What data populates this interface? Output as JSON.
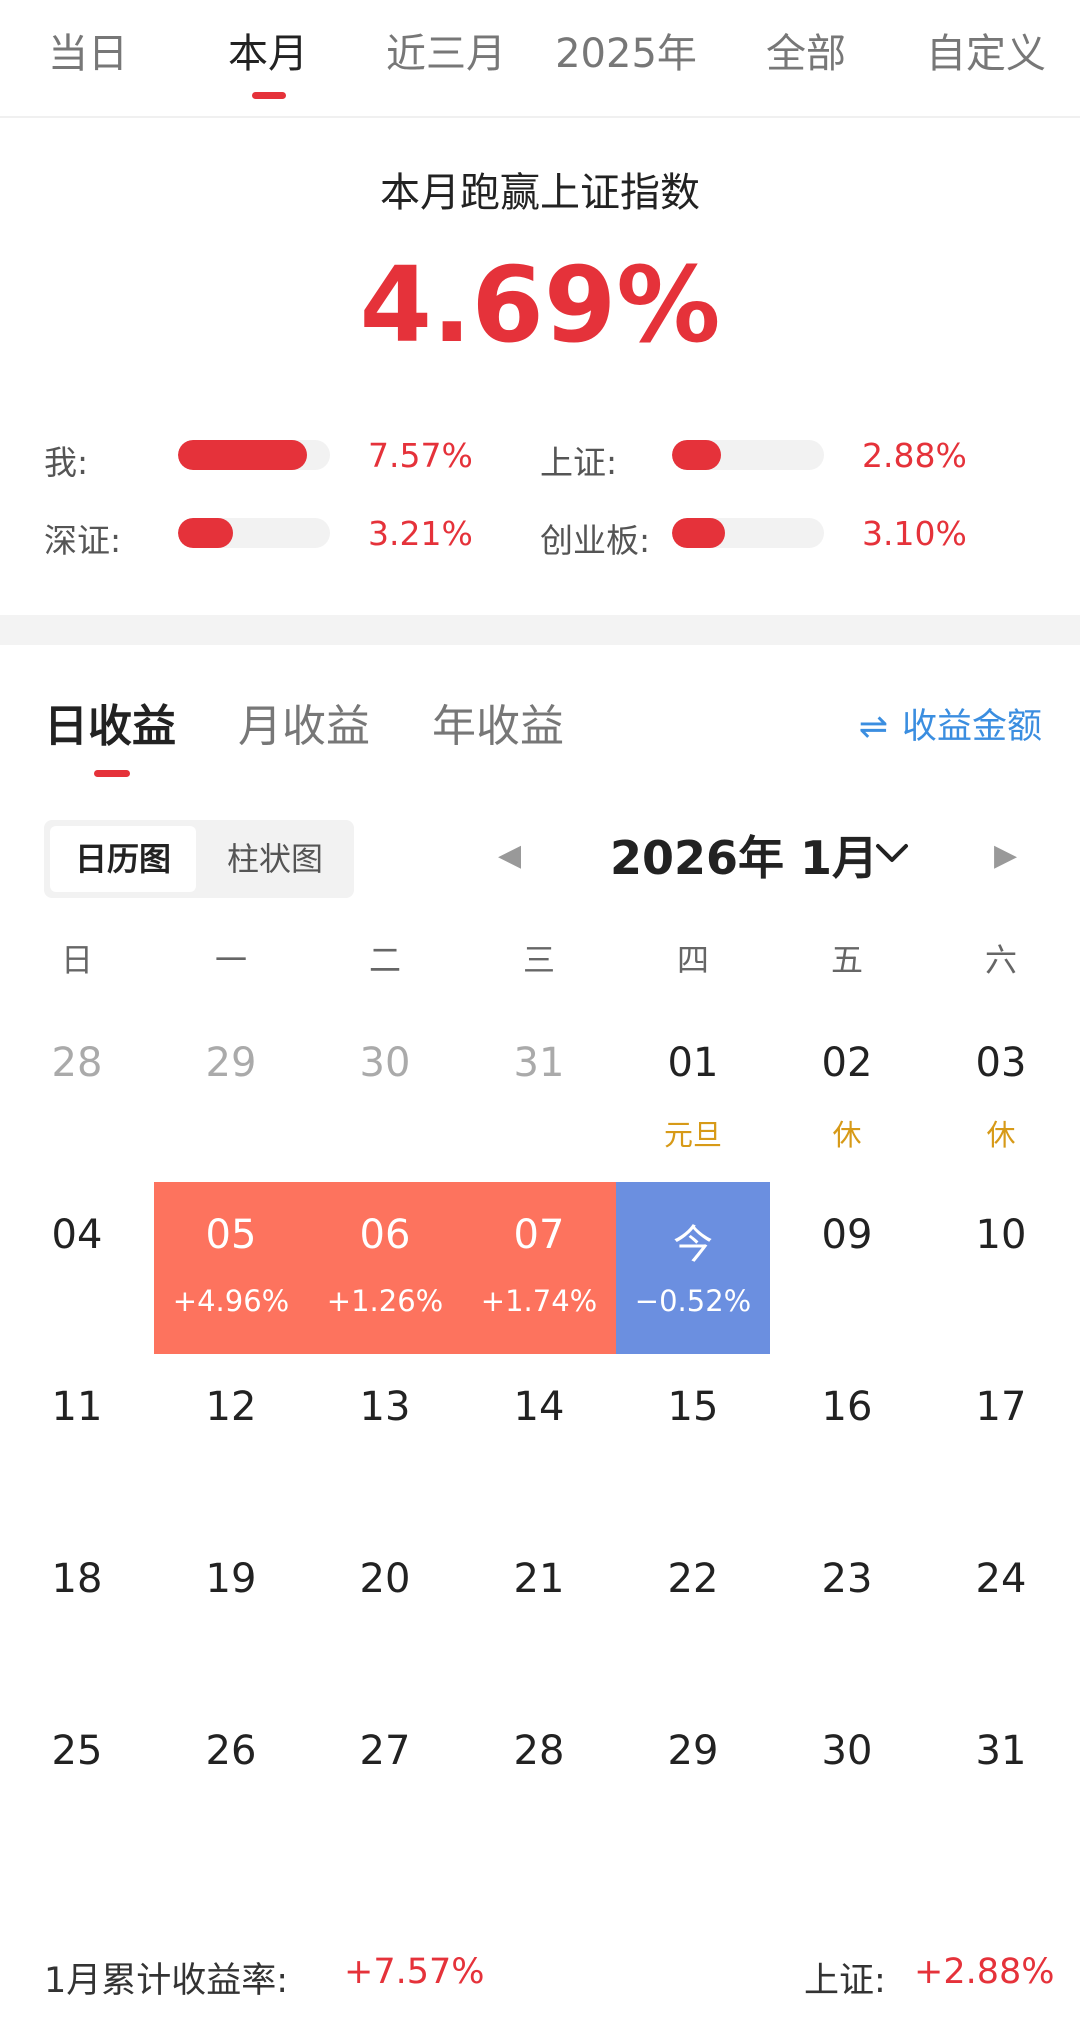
{
  "top_tabs": [
    {
      "label": "当日",
      "active": false
    },
    {
      "label": "本月",
      "active": true
    },
    {
      "label": "近三月",
      "active": false
    },
    {
      "label": "2025年",
      "active": false
    },
    {
      "label": "全部",
      "active": false
    },
    {
      "label": "自定义",
      "active": false
    }
  ],
  "outperform": {
    "title": "本月跑赢上证指数",
    "value": "4.69%"
  },
  "comparison": [
    {
      "label": "我:",
      "pct": "7.57%",
      "fill": 0.85
    },
    {
      "label": "上证:",
      "pct": "2.88%",
      "fill": 0.32
    },
    {
      "label": "深证:",
      "pct": "3.21%",
      "fill": 0.36
    },
    {
      "label": "创业板:",
      "pct": "3.10%",
      "fill": 0.35
    }
  ],
  "profit_tabs": [
    {
      "label": "日收益",
      "active": true
    },
    {
      "label": "月收益",
      "active": false
    },
    {
      "label": "年收益",
      "active": false
    }
  ],
  "amount_toggle": {
    "icon": "swap-icon",
    "glyph": "⇌",
    "label": "收益金额"
  },
  "view_switch": {
    "calendar": "日历图",
    "bar": "柱状图",
    "active": "日历图"
  },
  "month_nav": {
    "prev_glyph": "◀",
    "title": "2026年 1月",
    "next_glyph": "▶"
  },
  "weekdays": [
    "日",
    "一",
    "二",
    "三",
    "四",
    "五",
    "六"
  ],
  "calendar": [
    [
      {
        "day": "28",
        "muted": true
      },
      {
        "day": "29",
        "muted": true
      },
      {
        "day": "30",
        "muted": true
      },
      {
        "day": "31",
        "muted": true
      },
      {
        "day": "01",
        "sub": "元旦"
      },
      {
        "day": "02",
        "sub": "休"
      },
      {
        "day": "03",
        "sub": "休"
      }
    ],
    [
      {
        "day": "04"
      },
      {
        "day": "05",
        "sub": "+4.96%",
        "tone": "red"
      },
      {
        "day": "06",
        "sub": "+1.26%",
        "tone": "red"
      },
      {
        "day": "07",
        "sub": "+1.74%",
        "tone": "red"
      },
      {
        "day": "今",
        "sub": "−0.52%",
        "tone": "blue"
      },
      {
        "day": "09"
      },
      {
        "day": "10"
      }
    ],
    [
      {
        "day": "11"
      },
      {
        "day": "12"
      },
      {
        "day": "13"
      },
      {
        "day": "14"
      },
      {
        "day": "15"
      },
      {
        "day": "16"
      },
      {
        "day": "17"
      }
    ],
    [
      {
        "day": "18"
      },
      {
        "day": "19"
      },
      {
        "day": "20"
      },
      {
        "day": "21"
      },
      {
        "day": "22"
      },
      {
        "day": "23"
      },
      {
        "day": "24"
      }
    ],
    [
      {
        "day": "25"
      },
      {
        "day": "26"
      },
      {
        "day": "27"
      },
      {
        "day": "28"
      },
      {
        "day": "29"
      },
      {
        "day": "30"
      },
      {
        "day": "31"
      }
    ]
  ],
  "footer": {
    "left_label": "1月累计收益率:",
    "left_value": "+7.57%",
    "right_label": "上证:",
    "right_value": "+2.88%"
  },
  "colors": {
    "red": "#e5323a",
    "gain_cell": "#fd735e",
    "loss_cell": "#6b8fe0",
    "holiday": "#d79a18",
    "link": "#3b8ee0"
  }
}
